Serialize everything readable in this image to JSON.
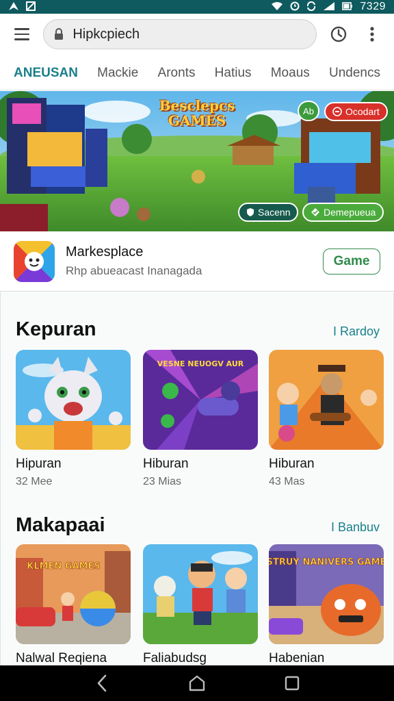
{
  "status": {
    "time": "7329"
  },
  "search": {
    "value": "Hipkcpiech"
  },
  "tabs": [
    "ANEUSAN",
    "Mackie",
    "Aronts",
    "Hatius",
    "Moaus",
    "Undencs"
  ],
  "banner": {
    "title": "Besclepcs GAMES",
    "badge_ab": "Ab",
    "badge_red": "Ocodart",
    "pill_dark": "Sacenn",
    "pill_green": "Demepueua"
  },
  "app": {
    "name": "Markesplace",
    "subtitle": "Rhp abueacast Inanagada",
    "button": "Game"
  },
  "sections": [
    {
      "title": "Kepuran",
      "link": "I Rardoy",
      "cards": [
        {
          "title": "Hipuran",
          "sub": "32 Mee"
        },
        {
          "title": "Hiburan",
          "sub": "23 Mias"
        },
        {
          "title": "Hiburan",
          "sub": "43 Mas"
        }
      ]
    },
    {
      "title": "Makapaai",
      "link": "I Banbuv",
      "cards": [
        {
          "title": "Nalwal Reqiena",
          "sub": ""
        },
        {
          "title": "Faliabudsg",
          "sub": ""
        },
        {
          "title": "Habenian",
          "sub": ""
        }
      ]
    }
  ],
  "thumb_text": {
    "card2": "VESNE NEUOGV AUR",
    "card4": "KLMEN GAMES",
    "card6": "STRUY NANIVERS GAME"
  },
  "colors": {
    "status_bar": "#0e5a5e",
    "accent": "#1a7f8a",
    "game_button": "#2f8a4a"
  },
  "icons": [
    "menu-icon",
    "lock-icon",
    "history-icon",
    "more-vert-icon",
    "back-icon",
    "home-icon",
    "recents-icon"
  ]
}
